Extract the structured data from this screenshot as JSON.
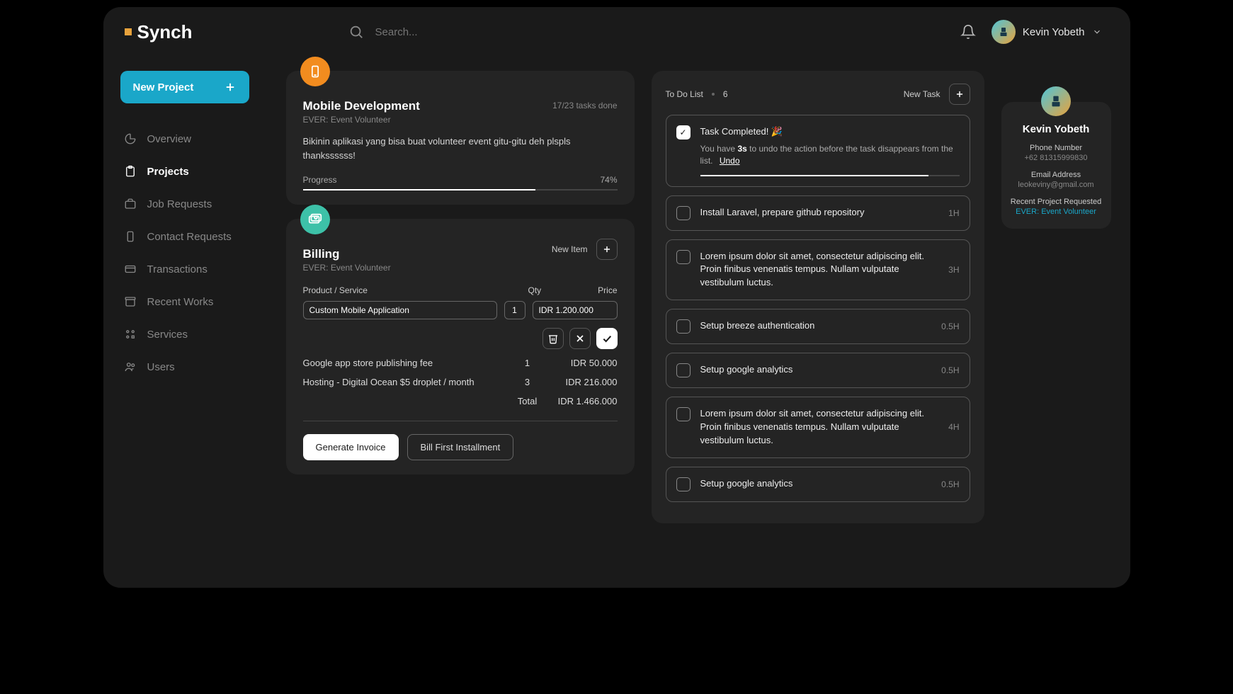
{
  "brand": "Synch",
  "search": {
    "placeholder": "Search..."
  },
  "user": {
    "name": "Kevin Yobeth"
  },
  "sidebar": {
    "new_project": "New Project",
    "items": [
      {
        "label": "Overview",
        "active": false
      },
      {
        "label": "Projects",
        "active": true
      },
      {
        "label": "Job Requests",
        "active": false
      },
      {
        "label": "Contact Requests",
        "active": false
      },
      {
        "label": "Transactions",
        "active": false
      },
      {
        "label": "Recent Works",
        "active": false
      },
      {
        "label": "Services",
        "active": false
      },
      {
        "label": "Users",
        "active": false
      }
    ]
  },
  "project": {
    "title": "Mobile Development",
    "subtitle": "EVER: Event Volunteer",
    "tasks_done": "17/23 tasks done",
    "description": "Bikinin aplikasi yang bisa buat volunteer event gitu-gitu deh plspls thankssssss!",
    "progress_label": "Progress",
    "progress_pct": "74%",
    "progress_val": 74
  },
  "billing": {
    "title": "Billing",
    "subtitle": "EVER: Event Volunteer",
    "new_item": "New Item",
    "headers": {
      "product": "Product / Service",
      "qty": "Qty",
      "price": "Price"
    },
    "input": {
      "product": "Custom Mobile Application",
      "qty": "1",
      "price": "IDR 1.200.000"
    },
    "rows": [
      {
        "name": "Google app store publishing fee",
        "qty": "1",
        "price": "IDR 50.000"
      },
      {
        "name": "Hosting - Digital Ocean $5 droplet / month",
        "qty": "3",
        "price": "IDR 216.000"
      }
    ],
    "total_label": "Total",
    "total": "IDR 1.466.000",
    "generate_btn": "Generate Invoice",
    "bill_first_btn": "Bill First Installment"
  },
  "todo": {
    "header_label": "To Do List",
    "count": "6",
    "new_task": "New Task",
    "completed": {
      "title": "Task Completed! 🎉",
      "undo_prefix": "You have ",
      "undo_time": "3s",
      "undo_suffix": " to undo the action before the task disappears from the list.",
      "undo_btn": "Undo"
    },
    "tasks": [
      {
        "text": "Install Laravel, prepare github repository",
        "dur": "1H"
      },
      {
        "text": "Lorem ipsum dolor sit amet, consectetur adipiscing elit. Proin finibus venenatis tempus.  Nullam vulputate vestibulum luctus.",
        "dur": "3H"
      },
      {
        "text": "Setup breeze authentication",
        "dur": "0.5H"
      },
      {
        "text": "Setup google analytics",
        "dur": "0.5H"
      },
      {
        "text": "Lorem ipsum dolor sit amet, consectetur adipiscing elit. Proin finibus venenatis tempus.  Nullam vulputate vestibulum luctus.",
        "dur": "4H"
      },
      {
        "text": "Setup google analytics",
        "dur": "0.5H"
      }
    ]
  },
  "profile": {
    "name": "Kevin Yobeth",
    "phone_label": "Phone Number",
    "phone": "+62 81315999830",
    "email_label": "Email Address",
    "email": "leokeviny@gmail.com",
    "recent_label": "Recent Project Requested",
    "recent": "EVER: Event Volunteer"
  }
}
